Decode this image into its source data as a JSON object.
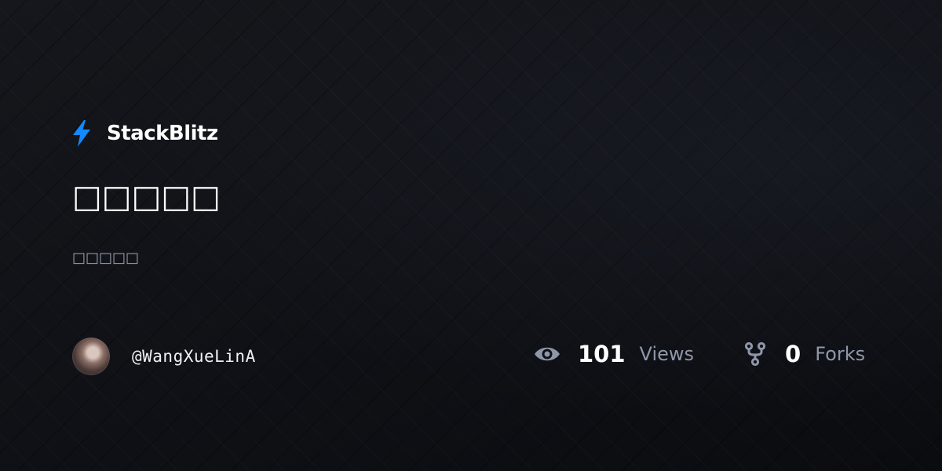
{
  "brand": {
    "name": "StackBlitz",
    "icon": "bolt-icon",
    "accent": "#1389fd"
  },
  "project": {
    "title": "□□□□□",
    "description": "□□□□□"
  },
  "author": {
    "username": "@WangXueLinA"
  },
  "stats": {
    "views": {
      "count": "101",
      "label": "Views",
      "icon": "eye-icon"
    },
    "forks": {
      "count": "0",
      "label": "Forks",
      "icon": "fork-icon"
    }
  },
  "colors": {
    "background": "#0d0f13",
    "text": "#ffffff",
    "muted": "#8e97a8"
  }
}
